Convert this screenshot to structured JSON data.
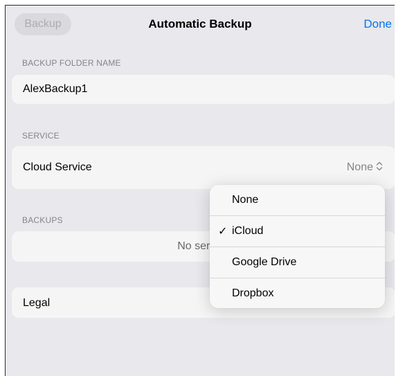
{
  "navbar": {
    "back_label": "Backup",
    "title": "Automatic Backup",
    "done_label": "Done"
  },
  "folder_section": {
    "header": "BACKUP FOLDER NAME",
    "value": "AlexBackup1"
  },
  "service_section": {
    "header": "SERVICE",
    "label": "Cloud Service",
    "value": "None"
  },
  "backups_section": {
    "header": "BACKUPS",
    "empty_text": "No service"
  },
  "legal": {
    "label": "Legal"
  },
  "menu": {
    "items": [
      {
        "label": "None",
        "checked": false
      },
      {
        "label": "iCloud",
        "checked": true
      },
      {
        "label": "Google Drive",
        "checked": false
      },
      {
        "label": "Dropbox",
        "checked": false
      }
    ],
    "check_glyph": "✓"
  },
  "colors": {
    "accent": "#007aff",
    "background": "#f2f2f7",
    "secondary_text": "#8a8a8e"
  }
}
